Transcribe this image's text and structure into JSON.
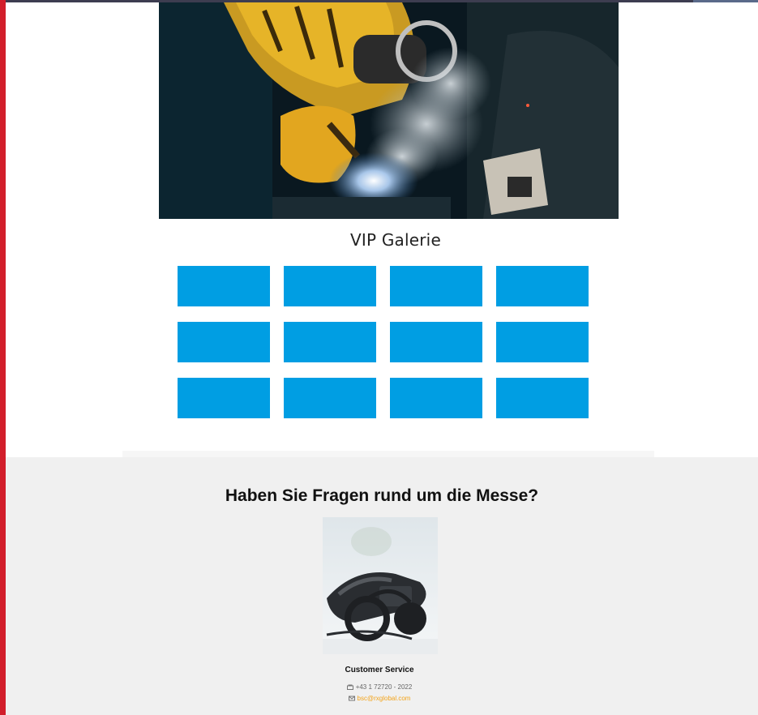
{
  "gallery": {
    "title": "VIP Galerie",
    "thumbnails": 12,
    "thumb_color": "#009ee3"
  },
  "contact": {
    "heading": "Haben Sie Fragen rund um die Messe?",
    "name": "Customer Service",
    "phone": "+43 1 72720 - 2022",
    "email": "bsc@rxglobal.com",
    "phone_icon": "phone-icon",
    "mail_icon": "mail-icon"
  },
  "colors": {
    "accent_left": "#d21e2b",
    "email_link": "#f3a41b",
    "contact_bg": "#f0f0f0"
  }
}
